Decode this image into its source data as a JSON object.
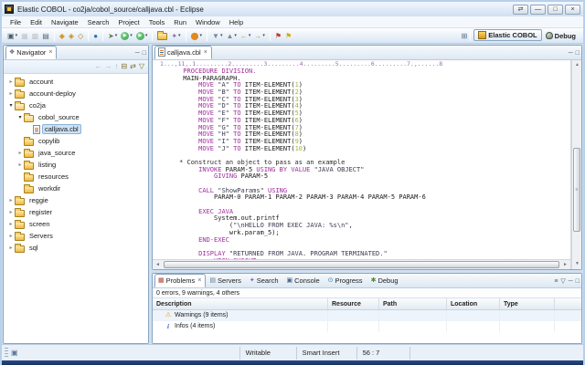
{
  "window": {
    "title": "Elastic COBOL - co2ja/cobol_source/calljava.cbl - Eclipse",
    "buttons": [
      {
        "name": "window-restore-button",
        "glyph": "⇄"
      },
      {
        "name": "window-minimize-button",
        "glyph": "—"
      },
      {
        "name": "window-maximize-button",
        "glyph": "□"
      },
      {
        "name": "window-close-button",
        "glyph": "×"
      }
    ]
  },
  "menubar": [
    "File",
    "Edit",
    "Navigate",
    "Search",
    "Project",
    "Tools",
    "Run",
    "Window",
    "Help"
  ],
  "toolbar": {
    "groups": [
      {
        "items": [
          {
            "name": "new-wizard-button",
            "glyph": "▣",
            "fg": "#4a5a6a",
            "dd": true
          },
          {
            "name": "save-button",
            "glyph": "▦",
            "fg": "#778088",
            "disabled": true
          },
          {
            "name": "save-all-button",
            "glyph": "▩",
            "fg": "#778088",
            "disabled": true
          },
          {
            "name": "print-button",
            "glyph": "▤",
            "fg": "#5a6a7a"
          }
        ]
      },
      {
        "items": [
          {
            "name": "cobol-build-button",
            "glyph": "◆",
            "fg": "#d79b2a"
          },
          {
            "name": "cobol-build-all-button",
            "glyph": "◈",
            "fg": "#c8871f"
          },
          {
            "name": "cobol-clean-button",
            "glyph": "◇",
            "fg": "#a87a1c"
          }
        ]
      },
      {
        "items": [
          {
            "name": "web-browser-button",
            "glyph": "●",
            "fg": "#2e6fb0"
          }
        ]
      },
      {
        "items": [
          {
            "name": "external-tools-button",
            "glyph": "➤",
            "fg": "#6a7a4a",
            "dd": true
          },
          {
            "name": "run-button",
            "glyph": "▶",
            "fg": "#ffffff",
            "bg": "#2f9e44",
            "shape": "circle",
            "dd": true
          },
          {
            "name": "run-last-launched-button",
            "glyph": "▶",
            "fg": "#ffffff",
            "bg": "#2f9e44",
            "shape": "circle",
            "dd": true
          }
        ]
      },
      {
        "items": [
          {
            "name": "open-resource-button",
            "shape": "folder"
          },
          {
            "name": "tag-search-button",
            "glyph": "✦",
            "fg": "#9a6ab0",
            "dd": true
          }
        ]
      },
      {
        "items": [
          {
            "name": "data-source-explorer-button",
            "glyph": "⬤",
            "fg": "#e08a1e",
            "dd": true
          }
        ]
      },
      {
        "items": [
          {
            "name": "next-annotation-button",
            "glyph": "▼",
            "fg": "#7a8a9a",
            "dd": true
          },
          {
            "name": "previous-annotation-button",
            "glyph": "▲",
            "fg": "#7a8a9a",
            "dd": true
          },
          {
            "name": "back-history-button",
            "glyph": "←",
            "fg": "#c2a13c",
            "dd": true
          },
          {
            "name": "forward-history-button",
            "glyph": "→",
            "fg": "#c2a13c",
            "dd": true
          }
        ]
      },
      {
        "items": [
          {
            "name": "marker-red-button",
            "glyph": "⚑",
            "fg": "#c0392b"
          },
          {
            "name": "marker-yellow-button",
            "glyph": "⚑",
            "fg": "#d4ac0d"
          }
        ]
      }
    ]
  },
  "perspectives": {
    "open_icon": "⊞",
    "items": [
      {
        "label": "Elastic COBOL",
        "active": true,
        "picon": "ec"
      },
      {
        "label": "Debug",
        "active": false,
        "picon": "bug"
      }
    ]
  },
  "navigator": {
    "title": "Navigator",
    "tools": [
      {
        "name": "back-tool",
        "glyph": "←",
        "disabled": true
      },
      {
        "name": "forward-tool",
        "glyph": "→",
        "disabled": true
      },
      {
        "name": "up-tool",
        "glyph": "↑",
        "disabled": true
      },
      {
        "name": "collapse-all-tool",
        "glyph": "⊟",
        "disabled": false
      },
      {
        "name": "link-with-editor-tool",
        "glyph": "⇄",
        "disabled": false
      },
      {
        "name": "view-menu-tool",
        "glyph": "▽",
        "disabled": false
      }
    ],
    "tree": [
      {
        "label": "account",
        "depth": 0,
        "icon": "folder",
        "exp": "collapsed",
        "selected": false
      },
      {
        "label": "account-deploy",
        "depth": 0,
        "icon": "folder",
        "exp": "collapsed",
        "selected": false
      },
      {
        "label": "co2ja",
        "depth": 0,
        "icon": "folder-open",
        "exp": "expanded",
        "selected": false
      },
      {
        "label": "cobol_source",
        "depth": 1,
        "icon": "folder-open",
        "exp": "expanded",
        "selected": false
      },
      {
        "label": "calljava.cbl",
        "depth": 2,
        "icon": "file-cobol",
        "exp": "none",
        "selected": true
      },
      {
        "label": "copylib",
        "depth": 1,
        "icon": "folder",
        "exp": "none",
        "selected": false
      },
      {
        "label": "java_source",
        "depth": 1,
        "icon": "folder",
        "exp": "collapsed",
        "selected": false
      },
      {
        "label": "listing",
        "depth": 1,
        "icon": "folder",
        "exp": "collapsed",
        "selected": false
      },
      {
        "label": "resources",
        "depth": 1,
        "icon": "folder",
        "exp": "none",
        "selected": false
      },
      {
        "label": "workdir",
        "depth": 1,
        "icon": "folder",
        "exp": "none",
        "selected": false
      },
      {
        "label": "reggie",
        "depth": 0,
        "icon": "folder",
        "exp": "collapsed",
        "selected": false
      },
      {
        "label": "register",
        "depth": 0,
        "icon": "folder",
        "exp": "collapsed",
        "selected": false
      },
      {
        "label": "screen",
        "depth": 0,
        "icon": "folder",
        "exp": "collapsed",
        "selected": false
      },
      {
        "label": "Servers",
        "depth": 0,
        "icon": "folder",
        "exp": "collapsed",
        "selected": false
      },
      {
        "label": "sql",
        "depth": 0,
        "icon": "folder",
        "exp": "collapsed",
        "selected": false
      }
    ]
  },
  "editor": {
    "tab": "calljava.cbl",
    "ruler": "1...,11,.1.........2.........3.........4.........5.........6.........7.,......8",
    "lines": [
      [
        [
          "plain",
          "      "
        ],
        [
          "kw",
          "PROCEDURE DIVISION."
        ]
      ],
      [
        [
          "plain",
          "      MAIN-PARAGRAPH."
        ]
      ],
      [
        [
          "plain",
          "          "
        ],
        [
          "kw",
          "MOVE"
        ],
        [
          "plain",
          " "
        ],
        [
          "str",
          "\"A\""
        ],
        [
          "plain",
          " "
        ],
        [
          "kw",
          "TO"
        ],
        [
          "plain",
          " ITEM-ELEMENT("
        ],
        [
          "num",
          "1"
        ],
        [
          "plain",
          ")"
        ]
      ],
      [
        [
          "plain",
          "          "
        ],
        [
          "kw",
          "MOVE"
        ],
        [
          "plain",
          " "
        ],
        [
          "str",
          "\"B\""
        ],
        [
          "plain",
          " "
        ],
        [
          "kw",
          "TO"
        ],
        [
          "plain",
          " ITEM-ELEMENT("
        ],
        [
          "num",
          "2"
        ],
        [
          "plain",
          ")"
        ]
      ],
      [
        [
          "plain",
          "          "
        ],
        [
          "kw",
          "MOVE"
        ],
        [
          "plain",
          " "
        ],
        [
          "str",
          "\"C\""
        ],
        [
          "plain",
          " "
        ],
        [
          "kw",
          "TO"
        ],
        [
          "plain",
          " ITEM-ELEMENT("
        ],
        [
          "num",
          "3"
        ],
        [
          "plain",
          ")"
        ]
      ],
      [
        [
          "plain",
          "          "
        ],
        [
          "kw",
          "MOVE"
        ],
        [
          "plain",
          " "
        ],
        [
          "str",
          "\"D\""
        ],
        [
          "plain",
          " "
        ],
        [
          "kw",
          "TO"
        ],
        [
          "plain",
          " ITEM-ELEMENT("
        ],
        [
          "num",
          "4"
        ],
        [
          "plain",
          ")"
        ]
      ],
      [
        [
          "plain",
          "          "
        ],
        [
          "kw",
          "MOVE"
        ],
        [
          "plain",
          " "
        ],
        [
          "str",
          "\"E\""
        ],
        [
          "plain",
          " "
        ],
        [
          "kw",
          "TO"
        ],
        [
          "plain",
          " ITEM-ELEMENT("
        ],
        [
          "num",
          "5"
        ],
        [
          "plain",
          ")"
        ]
      ],
      [
        [
          "plain",
          "          "
        ],
        [
          "kw",
          "MOVE"
        ],
        [
          "plain",
          " "
        ],
        [
          "str",
          "\"F\""
        ],
        [
          "plain",
          " "
        ],
        [
          "kw",
          "TO"
        ],
        [
          "plain",
          " ITEM-ELEMENT("
        ],
        [
          "num",
          "6"
        ],
        [
          "plain",
          ")"
        ]
      ],
      [
        [
          "plain",
          "          "
        ],
        [
          "kw",
          "MOVE"
        ],
        [
          "plain",
          " "
        ],
        [
          "str",
          "\"G\""
        ],
        [
          "plain",
          " "
        ],
        [
          "kw",
          "TO"
        ],
        [
          "plain",
          " ITEM-ELEMENT("
        ],
        [
          "num",
          "7"
        ],
        [
          "plain",
          ")"
        ]
      ],
      [
        [
          "plain",
          "          "
        ],
        [
          "kw",
          "MOVE"
        ],
        [
          "plain",
          " "
        ],
        [
          "str",
          "\"H\""
        ],
        [
          "plain",
          " "
        ],
        [
          "kw",
          "TO"
        ],
        [
          "plain",
          " ITEM-ELEMENT("
        ],
        [
          "num",
          "8"
        ],
        [
          "plain",
          ")"
        ]
      ],
      [
        [
          "plain",
          "          "
        ],
        [
          "kw",
          "MOVE"
        ],
        [
          "plain",
          " "
        ],
        [
          "str",
          "\"I\""
        ],
        [
          "plain",
          " "
        ],
        [
          "kw",
          "TO"
        ],
        [
          "plain",
          " ITEM-ELEMENT("
        ],
        [
          "num",
          "9"
        ],
        [
          "plain",
          ")"
        ]
      ],
      [
        [
          "plain",
          "          "
        ],
        [
          "kw",
          "MOVE"
        ],
        [
          "plain",
          " "
        ],
        [
          "str",
          "\"J\""
        ],
        [
          "plain",
          " "
        ],
        [
          "kw",
          "TO"
        ],
        [
          "plain",
          " ITEM-ELEMENT("
        ],
        [
          "num",
          "10"
        ],
        [
          "plain",
          ")"
        ]
      ],
      [
        [
          "plain",
          ""
        ]
      ],
      [
        [
          "comment",
          "     * Construct an object to pass as an example"
        ]
      ],
      [
        [
          "plain",
          "          "
        ],
        [
          "kw",
          "INVOKE"
        ],
        [
          "plain",
          " PARAM-5 "
        ],
        [
          "kw",
          "USING BY VALUE"
        ],
        [
          "plain",
          " "
        ],
        [
          "str",
          "\"JAVA OBJECT\""
        ]
      ],
      [
        [
          "plain",
          "              "
        ],
        [
          "kw",
          "GIVING"
        ],
        [
          "plain",
          " PARAM-5"
        ]
      ],
      [
        [
          "plain",
          ""
        ]
      ],
      [
        [
          "plain",
          "          "
        ],
        [
          "kw",
          "CALL"
        ],
        [
          "plain",
          " "
        ],
        [
          "str",
          "\"ShowParams\""
        ],
        [
          "plain",
          " "
        ],
        [
          "kw",
          "USING"
        ]
      ],
      [
        [
          "plain",
          "              PARAM-0 PARAM-1 PARAM-2 PARAM-3 PARAM-4 PARAM-5 PARAM-6"
        ]
      ],
      [
        [
          "plain",
          ""
        ]
      ],
      [
        [
          "plain",
          "          "
        ],
        [
          "kw",
          "EXEC JAVA"
        ]
      ],
      [
        [
          "plain",
          "              System.out.printf"
        ]
      ],
      [
        [
          "plain",
          "                  ("
        ],
        [
          "str",
          "\"\\nHELLO FROM EXEC JAVA: %s\\n\""
        ],
        [
          "plain",
          ","
        ]
      ],
      [
        [
          "plain",
          "                  wrk.param_5);"
        ]
      ],
      [
        [
          "plain",
          "          "
        ],
        [
          "kw",
          "END-EXEC"
        ]
      ],
      [
        [
          "plain",
          ""
        ]
      ],
      [
        [
          "plain",
          "          "
        ],
        [
          "kw",
          "DISPLAY"
        ],
        [
          "plain",
          " "
        ],
        [
          "str",
          "\"RETURNED FROM JAVA. PROGRAM TERMINATED.\""
        ]
      ],
      [
        [
          "plain",
          "              "
        ],
        [
          "kw",
          "UPON SYSOUT"
        ]
      ]
    ]
  },
  "problems": {
    "tabs": [
      {
        "label": "Problems",
        "icon": "problems-icon",
        "glyph": "▦",
        "fg": "#aa4433",
        "active": true
      },
      {
        "label": "Servers",
        "icon": "servers-icon",
        "glyph": "▤",
        "fg": "#5a7a9a",
        "active": false
      },
      {
        "label": "Search",
        "icon": "search-icon",
        "glyph": "✦",
        "fg": "#8866aa",
        "active": false
      },
      {
        "label": "Console",
        "icon": "console-icon",
        "glyph": "▣",
        "fg": "#446688",
        "active": false
      },
      {
        "label": "Progress",
        "icon": "progress-icon",
        "glyph": "⊙",
        "fg": "#3377aa",
        "active": false
      },
      {
        "label": "Debug",
        "icon": "debug-icon",
        "glyph": "✱",
        "fg": "#558833",
        "active": false
      }
    ],
    "view_tools": [
      {
        "name": "filter-tool",
        "glyph": "≡"
      },
      {
        "name": "view-menu-tool",
        "glyph": "▽"
      },
      {
        "name": "minimize-view-tool",
        "glyph": "─"
      },
      {
        "name": "maximize-view-tool",
        "glyph": "□"
      }
    ],
    "summary": "0 errors, 9 warnings, 4 others",
    "columns": [
      "Description",
      "Resource",
      "Path",
      "Location",
      "Type"
    ],
    "rows": [
      {
        "icon": "warning",
        "label": "Warnings (9 items)"
      },
      {
        "icon": "info",
        "label": "Infos (4 items)"
      }
    ]
  },
  "statusbar": {
    "writable": "Writable",
    "insert_mode": "Smart Insert",
    "position": "56 : 7"
  },
  "colors": {
    "keyword": "#a12c9e",
    "string": "#3c3c50",
    "number": "#a8b432",
    "selection": "#cde2f5",
    "titlebar": "#cfe0f2",
    "window_border_bottom": "#16305e"
  }
}
